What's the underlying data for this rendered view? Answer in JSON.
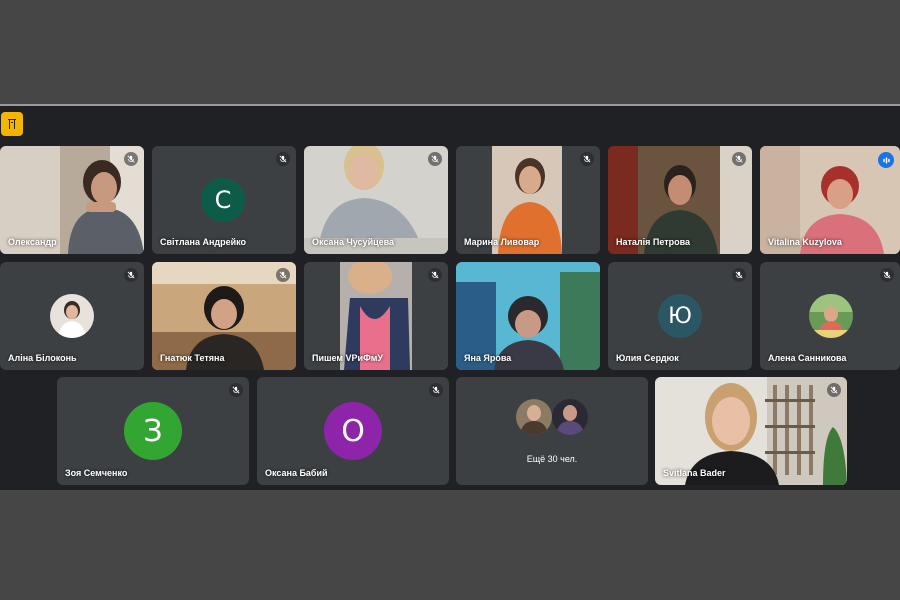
{
  "participants": [
    {
      "name": "Олександр"
    },
    {
      "name": "Світлана Андрейко",
      "initial": "С",
      "color": "#0d5c4a"
    },
    {
      "name": "Оксана Чусуйцева"
    },
    {
      "name": "Марина Ливовар"
    },
    {
      "name": "Наталія Петрова"
    },
    {
      "name": "Vitalina Kuzylova"
    },
    {
      "name": "Аліна Білоконь"
    },
    {
      "name": "Гнатюк Тетяна"
    },
    {
      "name": "Пишем VРиФмУ"
    },
    {
      "name": "Яна Ярова"
    },
    {
      "name": "Юлия Сердюк",
      "initial": "Ю",
      "color": "#2b5664"
    },
    {
      "name": "Алена Санникова"
    },
    {
      "name": "Зоя Семченко",
      "initial": "З",
      "color": "#33a532"
    },
    {
      "name": "Оксана Бабий",
      "initial": "О",
      "color": "#8e24aa"
    },
    {
      "name": "Svitlana Bader"
    }
  ],
  "more_tile": {
    "label": "Ещё 30 чел."
  },
  "icons": {
    "mic_off": "mic-off-icon",
    "speaking": "speaking-indicator-icon",
    "badge": "presentation-icon"
  },
  "colors": {
    "app_background": "#202124",
    "tile_background": "#3c4043",
    "active_outline": "#8ab4f8",
    "badge": "#f4b400"
  }
}
